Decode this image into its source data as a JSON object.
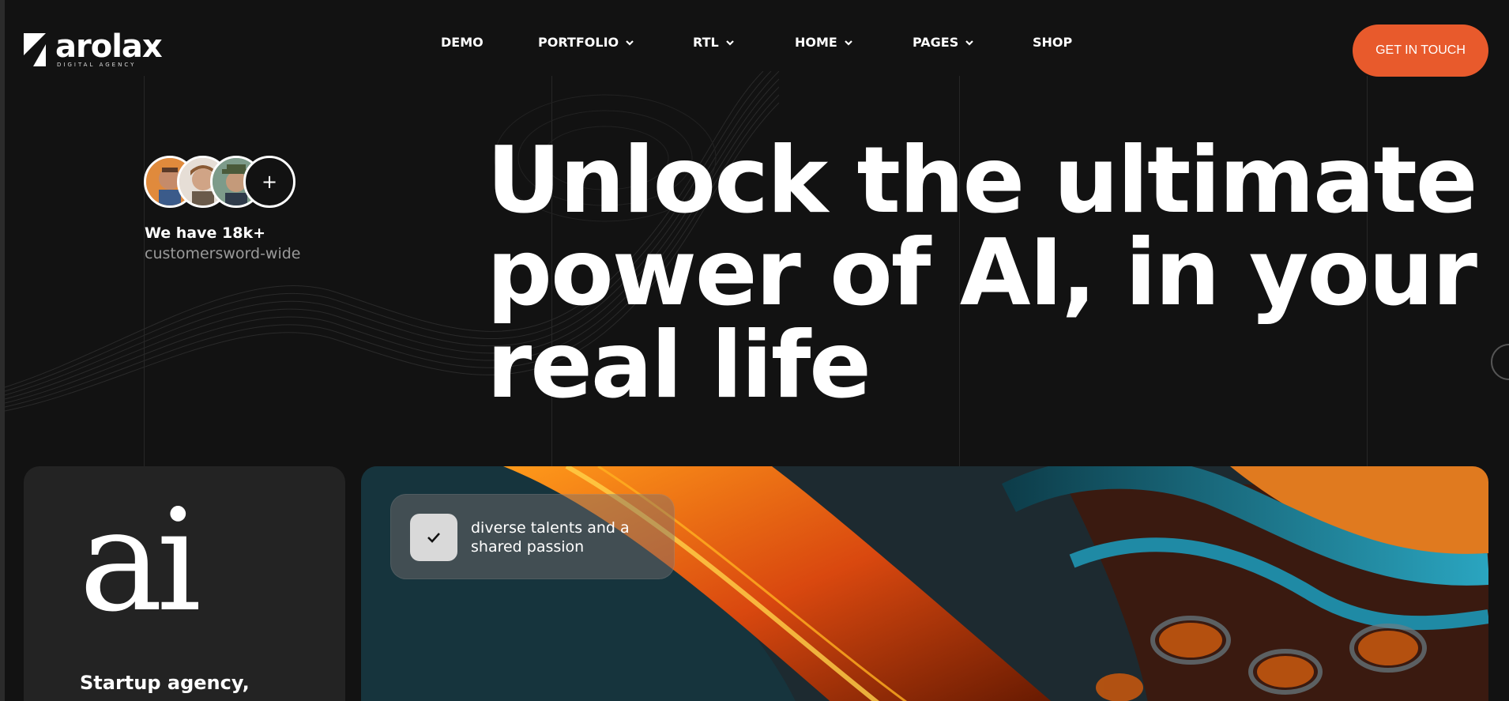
{
  "header": {
    "logo": {
      "wordmark": "arolax",
      "tagline": "DIGITAL AGENCY"
    },
    "nav": [
      {
        "label": "DEMO",
        "has_dropdown": false
      },
      {
        "label": "PORTFOLIO",
        "has_dropdown": true
      },
      {
        "label": "RTL",
        "has_dropdown": true
      },
      {
        "label": "HOME",
        "has_dropdown": true
      },
      {
        "label": "PAGES",
        "has_dropdown": true
      },
      {
        "label": "SHOP",
        "has_dropdown": false
      }
    ],
    "cta_label": "GET IN TOUCH"
  },
  "customers": {
    "plus_label": "+",
    "line1": "We have 18k+",
    "line2": "customersword-wide"
  },
  "hero": {
    "lines": [
      "Unlock the ultimate",
      "power of AI, in your",
      "real life"
    ]
  },
  "card": {
    "logo_text": "ai",
    "title": "Startup agency,"
  },
  "feature": {
    "icon": "check-icon",
    "text": "diverse talents and a shared passion"
  },
  "colors": {
    "background": "#121212",
    "accent": "#e85a2c",
    "card": "#232323"
  }
}
